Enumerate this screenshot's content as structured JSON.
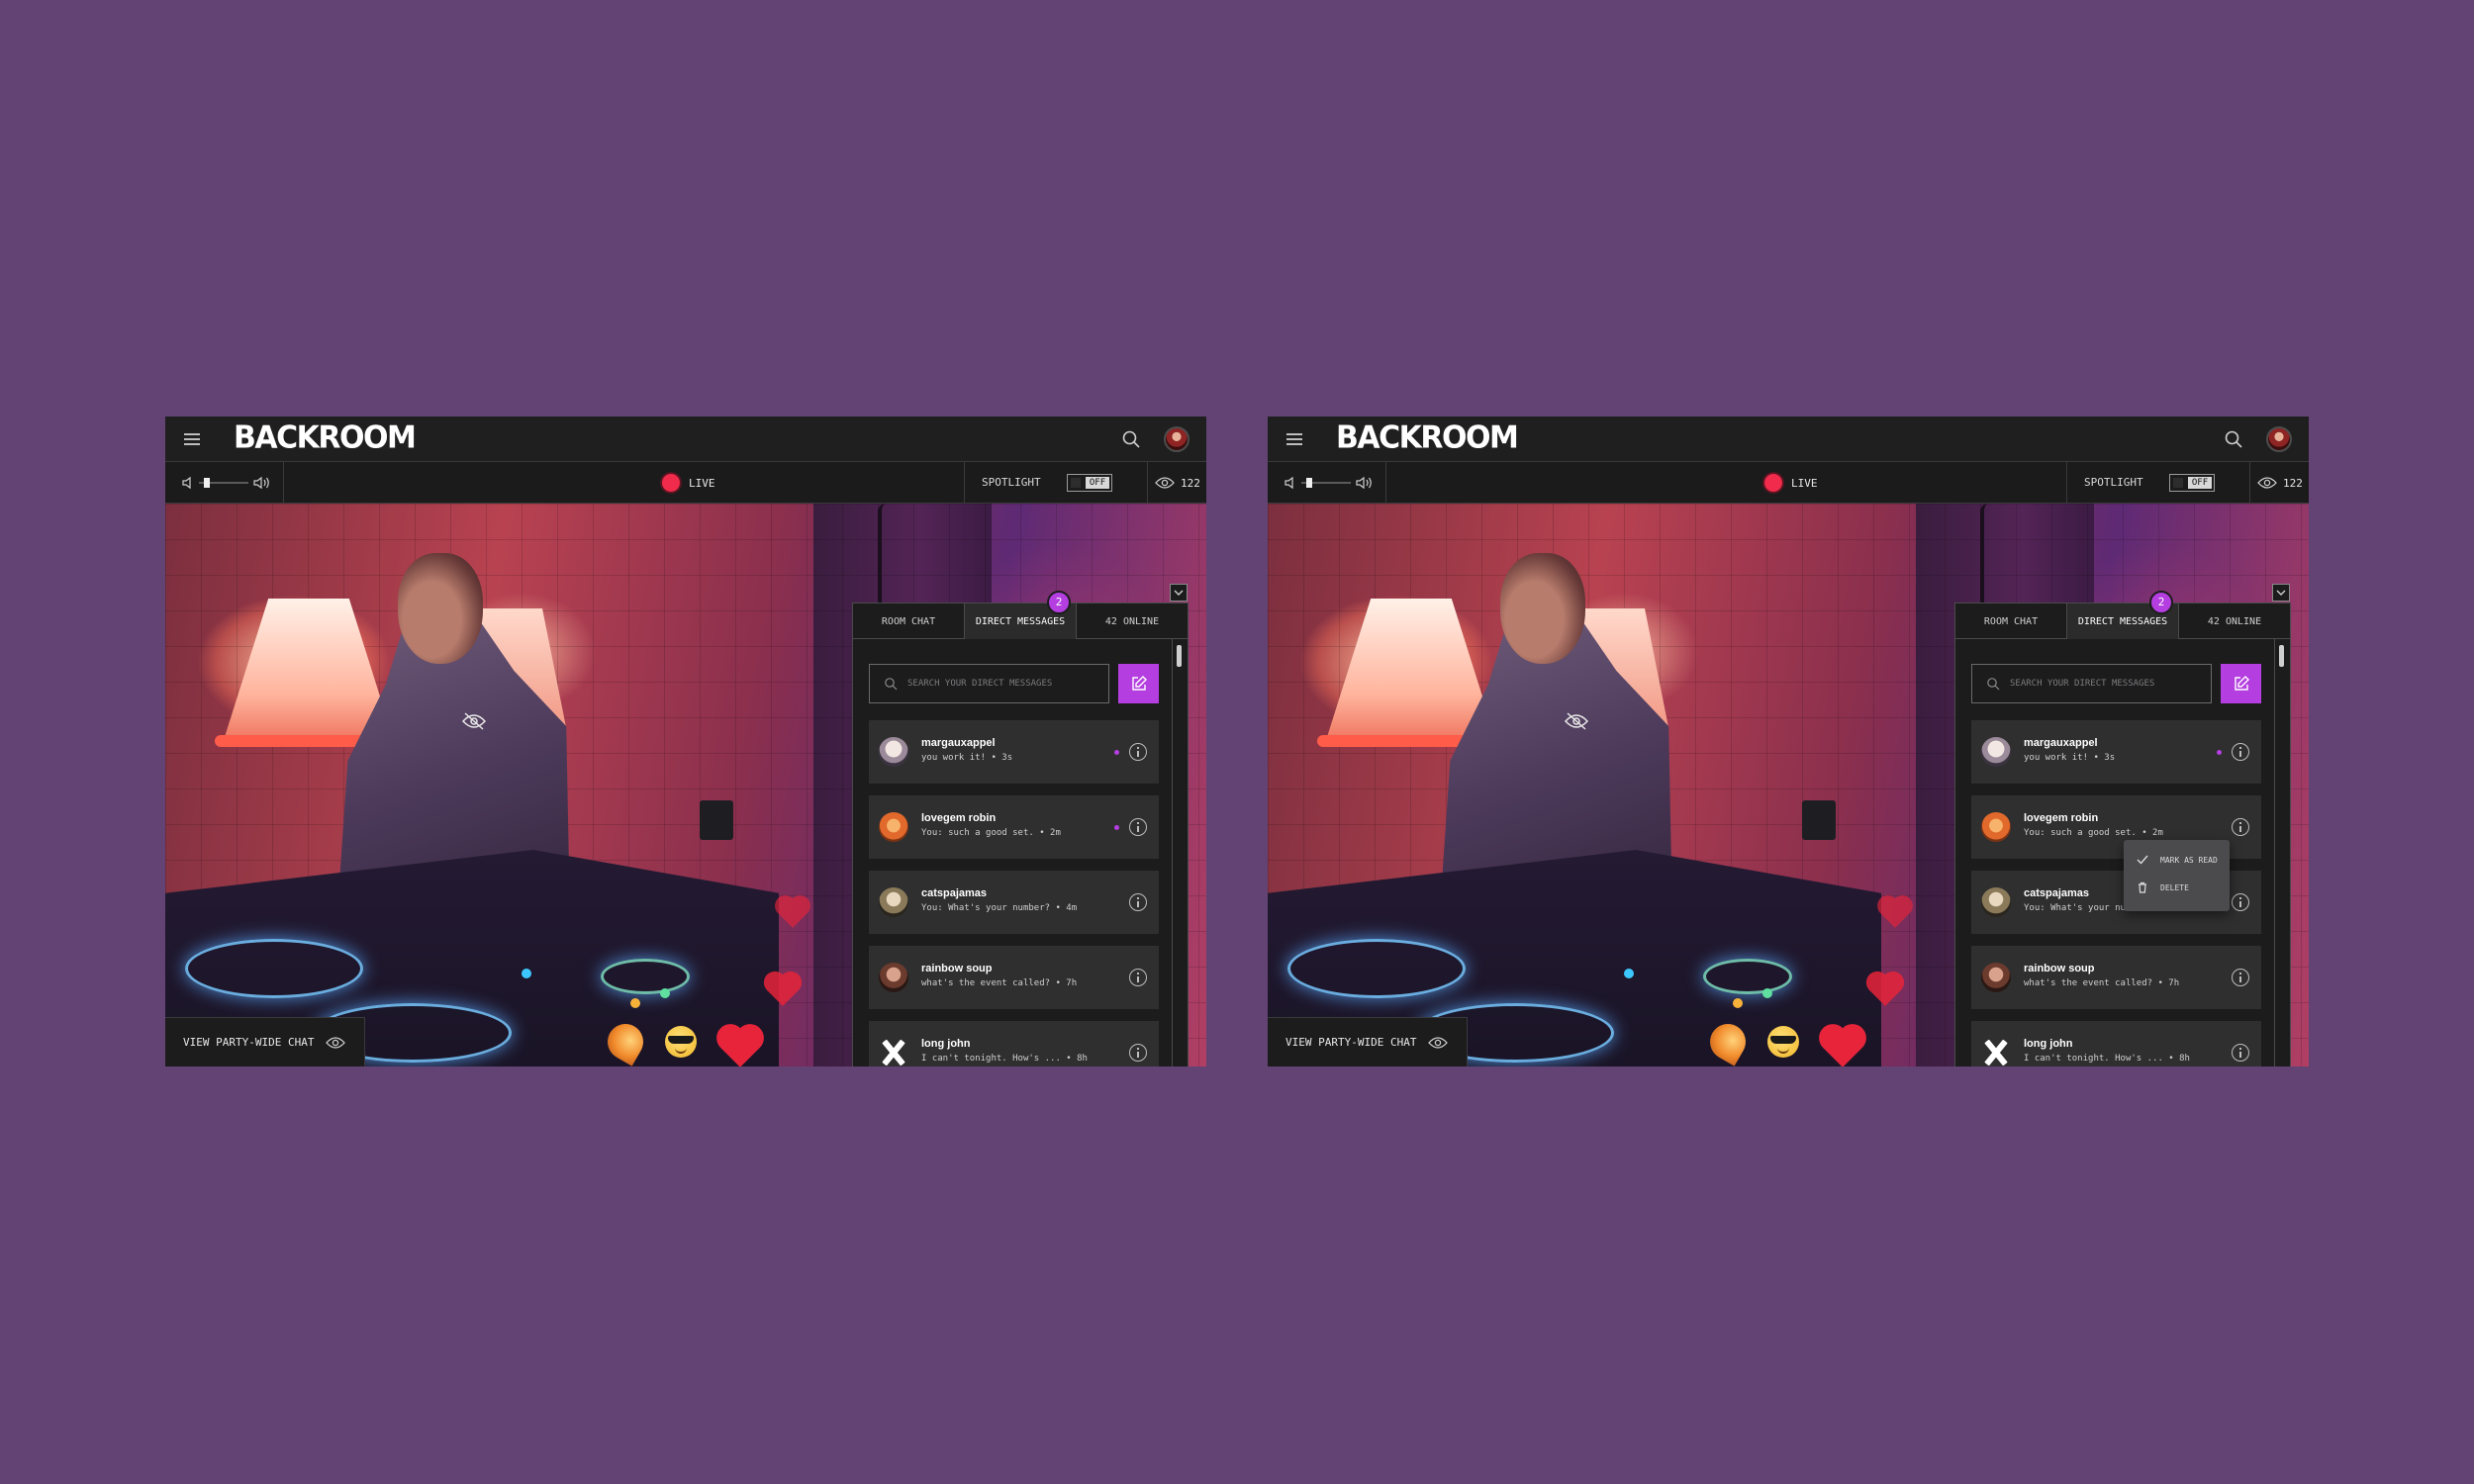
{
  "app": {
    "logo": "BACKROOM"
  },
  "controls": {
    "live_label": "LIVE",
    "spotlight_label": "SPOTLIGHT",
    "spotlight_state": "OFF",
    "viewer_count": "122",
    "volume_level": 0.15
  },
  "video": {
    "party_chat_label": "VIEW PARTY-WIDE CHAT",
    "reactions": [
      "taco",
      "sunglasses-face",
      "heart"
    ]
  },
  "chat": {
    "tabs": [
      "ROOM CHAT",
      "DIRECT MESSAGES",
      "42 ONLINE"
    ],
    "active_tab": "DIRECT MESSAGES",
    "unread_badge": "2",
    "search_placeholder": "SEARCH YOUR DIRECT MESSAGES",
    "messages": [
      {
        "name": "margauxappel",
        "preview": "you work it! • 3s",
        "unread": true
      },
      {
        "name": "lovegem robin",
        "preview": "You: such a good set. • 2m",
        "unread": true
      },
      {
        "name": "catspajamas",
        "preview": "You: What's your number? • 4m",
        "unread": false
      },
      {
        "name": "rainbow soup",
        "preview": "what's the event called? • 7h",
        "unread": false
      },
      {
        "name": "long john",
        "preview": "I can't tonight. How's ... • 8h",
        "unread": false
      }
    ]
  },
  "context_menu": {
    "mark_as_read": "MARK AS READ",
    "delete": "DELETE"
  },
  "colors": {
    "background": "#634374",
    "accent": "#b43ee0",
    "live": "#f02b4b",
    "panel": "#1c1c1d"
  }
}
